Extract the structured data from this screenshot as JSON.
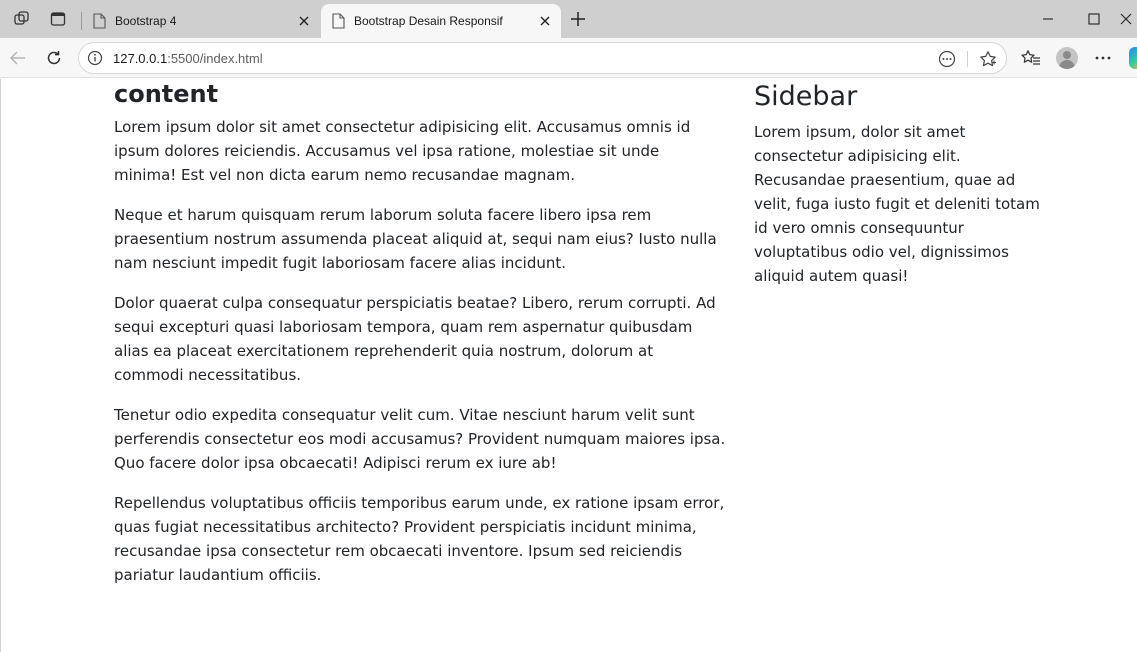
{
  "browser": {
    "tabs": [
      {
        "label": "Bootstrap 4",
        "active": false
      },
      {
        "label": "Bootstrap Desain Responsif",
        "active": true
      }
    ],
    "address": {
      "host": "127.0.0.1",
      "rest": ":5500/index.html"
    },
    "icons": {
      "workspaces": "workspaces-icon",
      "tab_actions": "tab-actions-icon",
      "page": "page-icon",
      "close": "close-icon",
      "new_tab": "plus-icon",
      "minimize": "minimize-icon",
      "maximize": "maximize-icon",
      "window_close": "window-close-icon",
      "back": "back-arrow-icon",
      "refresh": "refresh-icon",
      "info": "info-icon",
      "reader": "more-circle-icon",
      "favorite": "star-icon",
      "favorites": "favorites-icon",
      "menu": "more-horizontal-icon"
    }
  },
  "page": {
    "content": {
      "heading": "content",
      "paragraphs": [
        "Lorem ipsum dolor sit amet consectetur adipisicing elit. Accusamus omnis id ipsum dolores reiciendis. Accusamus vel ipsa ratione, molestiae sit unde minima! Est vel non dicta earum nemo recusandae magnam.",
        "Neque et harum quisquam rerum laborum soluta facere libero ipsa rem praesentium nostrum assumenda placeat aliquid at, sequi nam eius? Iusto nulla nam nesciunt impedit fugit laboriosam facere alias incidunt.",
        "Dolor quaerat culpa consequatur perspiciatis beatae? Libero, rerum corrupti. Ad sequi excepturi quasi laboriosam tempora, quam rem aspernatur quibusdam alias ea placeat exercitationem reprehenderit quia nostrum, dolorum at commodi necessitatibus.",
        "Tenetur odio expedita consequatur velit cum. Vitae nesciunt harum velit sunt perferendis consectetur eos modi accusamus? Provident numquam maiores ipsa. Quo facere dolor ipsa obcaecati! Adipisci rerum ex iure ab!",
        "Repellendus voluptatibus officiis temporibus earum unde, ex ratione ipsam error, quas fugiat necessitatibus architecto? Provident perspiciatis incidunt minima, recusandae ipsa consectetur rem obcaecati inventore. Ipsum sed reiciendis pariatur laudantium officiis."
      ]
    },
    "sidebar": {
      "heading": "Sidebar",
      "paragraph": "Lorem ipsum, dolor sit amet consectetur adipisicing elit. Recusandae praesentium, quae ad velit, fuga iusto fugit et deleniti totam id vero omnis consequuntur voluptatibus odio vel, dignissimos aliquid autem quasi!"
    }
  }
}
